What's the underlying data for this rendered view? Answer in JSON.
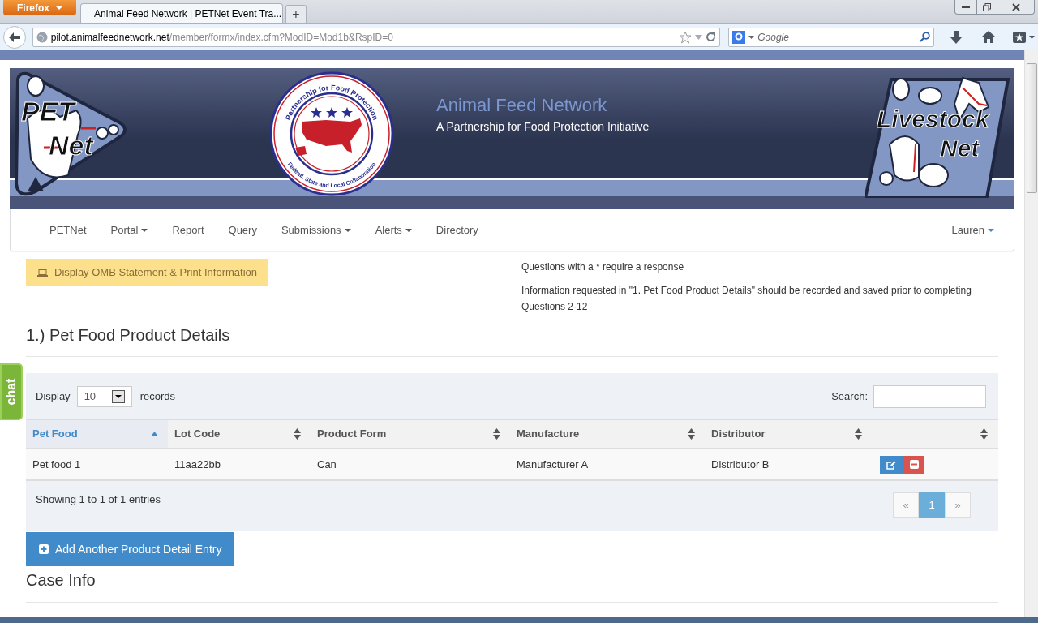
{
  "browser": {
    "menu_button": "Firefox",
    "tab_title": "Animal Feed Network | PETNet Event Tra...",
    "new_tab": "+",
    "url_host": "pilot.animalfeednetwork.net",
    "url_path": "/member/formx/index.cfm?ModID=Mod1b&RspID=0",
    "search_placeholder": "Google"
  },
  "header": {
    "title": "Animal Feed Network",
    "subtitle": "A Partnership for Food Protection Initiative",
    "left_logo": [
      "PET",
      "Net"
    ],
    "seal": {
      "top": "Partnership for Food Protection",
      "bottom": "Federal, State and Local Collaboration"
    },
    "right_logo": [
      "Livestock",
      "Net"
    ]
  },
  "nav": {
    "items": [
      {
        "label": "PETNet",
        "dropdown": false
      },
      {
        "label": "Portal",
        "dropdown": true
      },
      {
        "label": "Report",
        "dropdown": false
      },
      {
        "label": "Query",
        "dropdown": false
      },
      {
        "label": "Submissions",
        "dropdown": true
      },
      {
        "label": "Alerts",
        "dropdown": true
      },
      {
        "label": "Directory",
        "dropdown": false
      }
    ],
    "user": {
      "label": "Lauren",
      "dropdown": true
    }
  },
  "omb_button": "Display OMB Statement & Print Information",
  "notes": [
    "Questions with a * require a response",
    "Information requested in \"1. Pet Food Product Details\" should be recorded and saved prior to completing Questions 2-12"
  ],
  "section_title": "1.) Pet Food Product Details",
  "table": {
    "length_label": "Display",
    "length_value": "10",
    "length_suffix": "records",
    "search_label": "Search:",
    "columns": [
      {
        "label": "Pet Food",
        "sorted": true
      },
      {
        "label": "Lot Code",
        "sorted": false
      },
      {
        "label": "Product Form",
        "sorted": false
      },
      {
        "label": "Manufacture",
        "sorted": false
      },
      {
        "label": "Distributor",
        "sorted": false
      },
      {
        "sorted": false
      }
    ],
    "rows": [
      {
        "cells": [
          "Pet food 1",
          "11aa22bb",
          "Can",
          "Manufacturer A",
          "Distributor B"
        ]
      }
    ],
    "info": "Showing 1 to 1 of 1 entries",
    "pagination": [
      {
        "label": "«",
        "selected": false
      },
      {
        "label": "1",
        "selected": true
      },
      {
        "label": "»",
        "selected": false
      }
    ]
  },
  "add_button": "Add Another Product Detail Entry",
  "next_section": "Case Info",
  "chat_tab": "chat"
}
